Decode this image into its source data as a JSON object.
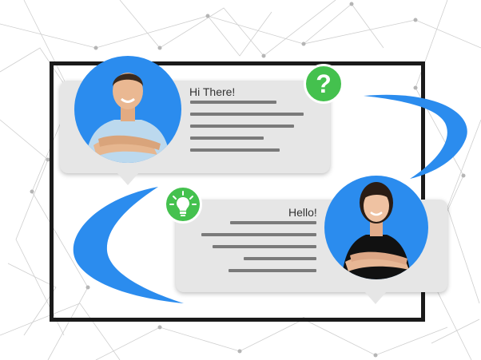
{
  "chat": {
    "message_1": {
      "greeting": "Hi There!",
      "speaker": "man-avatar"
    },
    "message_2": {
      "greeting": "Hello!",
      "speaker": "woman-avatar"
    }
  },
  "icons": {
    "question": "?",
    "question_icon_name": "question-mark-icon",
    "idea_icon_name": "lightbulb-icon"
  },
  "colors": {
    "accent_blue": "#2b8cee",
    "badge_green": "#44c14e",
    "bubble_gray": "#e6e6e6",
    "text_line_gray": "#7a7a7a",
    "frame_black": "#1a1a1a"
  }
}
